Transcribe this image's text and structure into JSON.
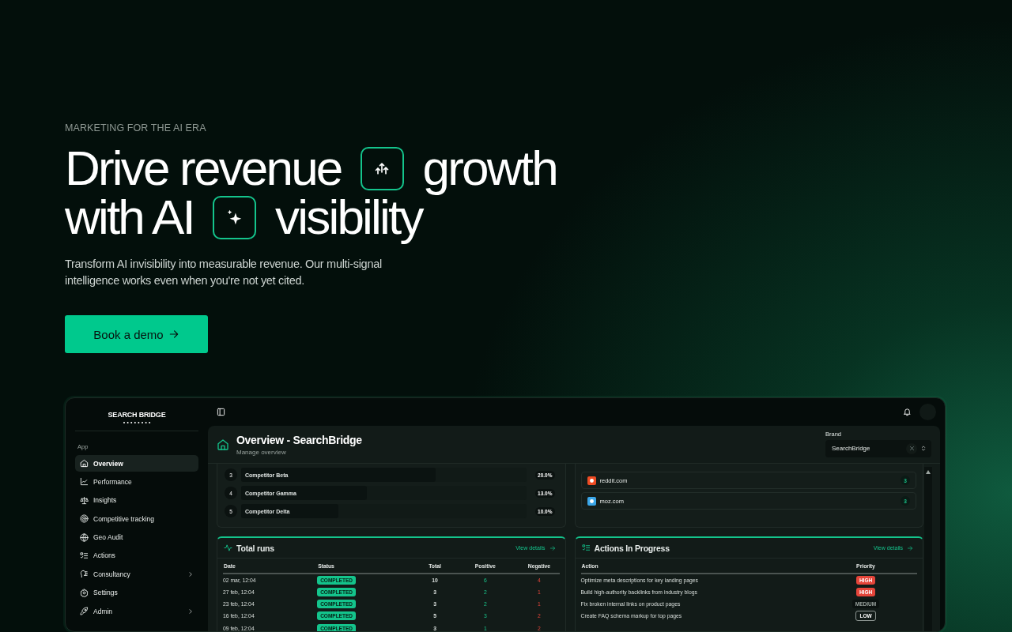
{
  "hero": {
    "eyebrow": "MARKETING FOR THE AI ERA",
    "headline": [
      {
        "before": "Drive revenue",
        "after": "growth"
      },
      {
        "before": "with AI",
        "after": "visibility"
      }
    ],
    "subtitle": "Transform AI invisibility into measurable revenue. Our multi-signal intelligence works even when you're not yet cited.",
    "cta": "Book a demo"
  },
  "dashboard": {
    "logo": "SEARCH BRIDGE",
    "sidebar": {
      "section": "App",
      "items": [
        {
          "label": "Overview",
          "selected": true,
          "expandable": false
        },
        {
          "label": "Performance",
          "selected": false,
          "expandable": false
        },
        {
          "label": "Insights",
          "selected": false,
          "expandable": false
        },
        {
          "label": "Competitive tracking",
          "selected": false,
          "expandable": false
        },
        {
          "label": "Geo Audit",
          "selected": false,
          "expandable": false
        },
        {
          "label": "Actions",
          "selected": false,
          "expandable": false
        },
        {
          "label": "Consultancy",
          "selected": false,
          "expandable": true
        },
        {
          "label": "Settings",
          "selected": false,
          "expandable": false
        },
        {
          "label": "Admin",
          "selected": false,
          "expandable": true
        }
      ]
    },
    "header": {
      "title": "Overview - SearchBridge",
      "subtitle": "Manage overview",
      "brand_label": "Brand",
      "brand_value": "SearchBridge"
    },
    "competitors": [
      {
        "rank": "3",
        "name": "Competitor Beta",
        "share": "20.0%",
        "level": 0.68
      },
      {
        "rank": "4",
        "name": "Competitor Gamma",
        "share": "13.0%",
        "level": 0.44
      },
      {
        "rank": "5",
        "name": "Competitor Delta",
        "share": "10.0%",
        "level": 0.34
      }
    ],
    "sources": [
      {
        "domain": "reddit.com",
        "count": "3",
        "color": "#ee4b23"
      },
      {
        "domain": "moz.com",
        "count": "3",
        "color": "#3aa6e8"
      }
    ],
    "runs": {
      "title": "Total runs",
      "link": "View details",
      "columns": [
        "Date",
        "Status",
        "Total",
        "Positive",
        "Negative"
      ],
      "rows": [
        {
          "date": "02 mar, 12:04",
          "status": "COMPLETED",
          "total": "10",
          "positive": "6",
          "negative": "4"
        },
        {
          "date": "27 feb, 12:04",
          "status": "COMPLETED",
          "total": "3",
          "positive": "2",
          "negative": "1"
        },
        {
          "date": "23 feb, 12:04",
          "status": "COMPLETED",
          "total": "3",
          "positive": "2",
          "negative": "1"
        },
        {
          "date": "16 feb, 12:04",
          "status": "COMPLETED",
          "total": "5",
          "positive": "3",
          "negative": "2"
        },
        {
          "date": "09 feb, 12:04",
          "status": "COMPLETED",
          "total": "3",
          "positive": "1",
          "negative": "2"
        }
      ]
    },
    "actions": {
      "title": "Actions In Progress",
      "link": "View details",
      "columns": [
        "Action",
        "Priority"
      ],
      "rows": [
        {
          "action": "Optimize meta descriptions for key landing pages",
          "priority": "HIGH",
          "kind": "high"
        },
        {
          "action": "Build high-authority backlinks from industry blogs",
          "priority": "HIGH",
          "kind": "high"
        },
        {
          "action": "Fix broken internal links on product pages",
          "priority": "MEDIUM",
          "kind": "medium"
        },
        {
          "action": "Create FAQ schema markup for top pages",
          "priority": "LOW",
          "kind": "low"
        }
      ]
    }
  }
}
